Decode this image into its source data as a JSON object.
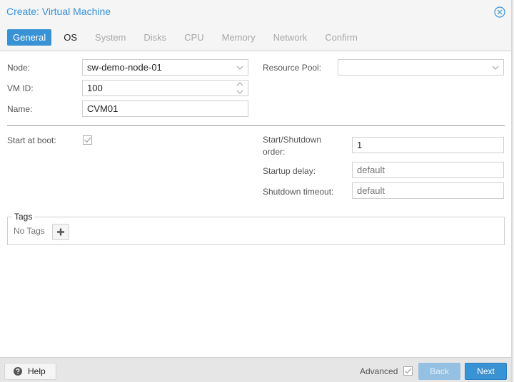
{
  "window": {
    "title": "Create: Virtual Machine",
    "close_icon": "circle-x-icon",
    "accent_color": "#3892d4"
  },
  "tabs": [
    {
      "label": "General",
      "state": "active"
    },
    {
      "label": "OS",
      "state": "enabled"
    },
    {
      "label": "System",
      "state": "disabled"
    },
    {
      "label": "Disks",
      "state": "disabled"
    },
    {
      "label": "CPU",
      "state": "disabled"
    },
    {
      "label": "Memory",
      "state": "disabled"
    },
    {
      "label": "Network",
      "state": "disabled"
    },
    {
      "label": "Confirm",
      "state": "disabled"
    }
  ],
  "form": {
    "node": {
      "label": "Node:",
      "value": "sw-demo-node-01"
    },
    "vmid": {
      "label": "VM ID:",
      "value": "100"
    },
    "name": {
      "label": "Name:",
      "value": "CVM01"
    },
    "resource_pool": {
      "label": "Resource Pool:",
      "value": ""
    },
    "start_at_boot": {
      "label": "Start at boot:",
      "checked": true
    },
    "start_shutdown_order": {
      "label_line1": "Start/Shutdown",
      "label_line2": "order:",
      "value": "1"
    },
    "startup_delay": {
      "label": "Startup delay:",
      "placeholder": "default"
    },
    "shutdown_timeout": {
      "label": "Shutdown timeout:",
      "placeholder": "default"
    }
  },
  "tags": {
    "legend": "Tags",
    "empty_text": "No Tags",
    "add_icon": "plus-icon"
  },
  "footer": {
    "help_label": "Help",
    "help_icon": "question-circle-icon",
    "advanced_label": "Advanced",
    "advanced_checked": true,
    "back_label": "Back",
    "next_label": "Next"
  }
}
